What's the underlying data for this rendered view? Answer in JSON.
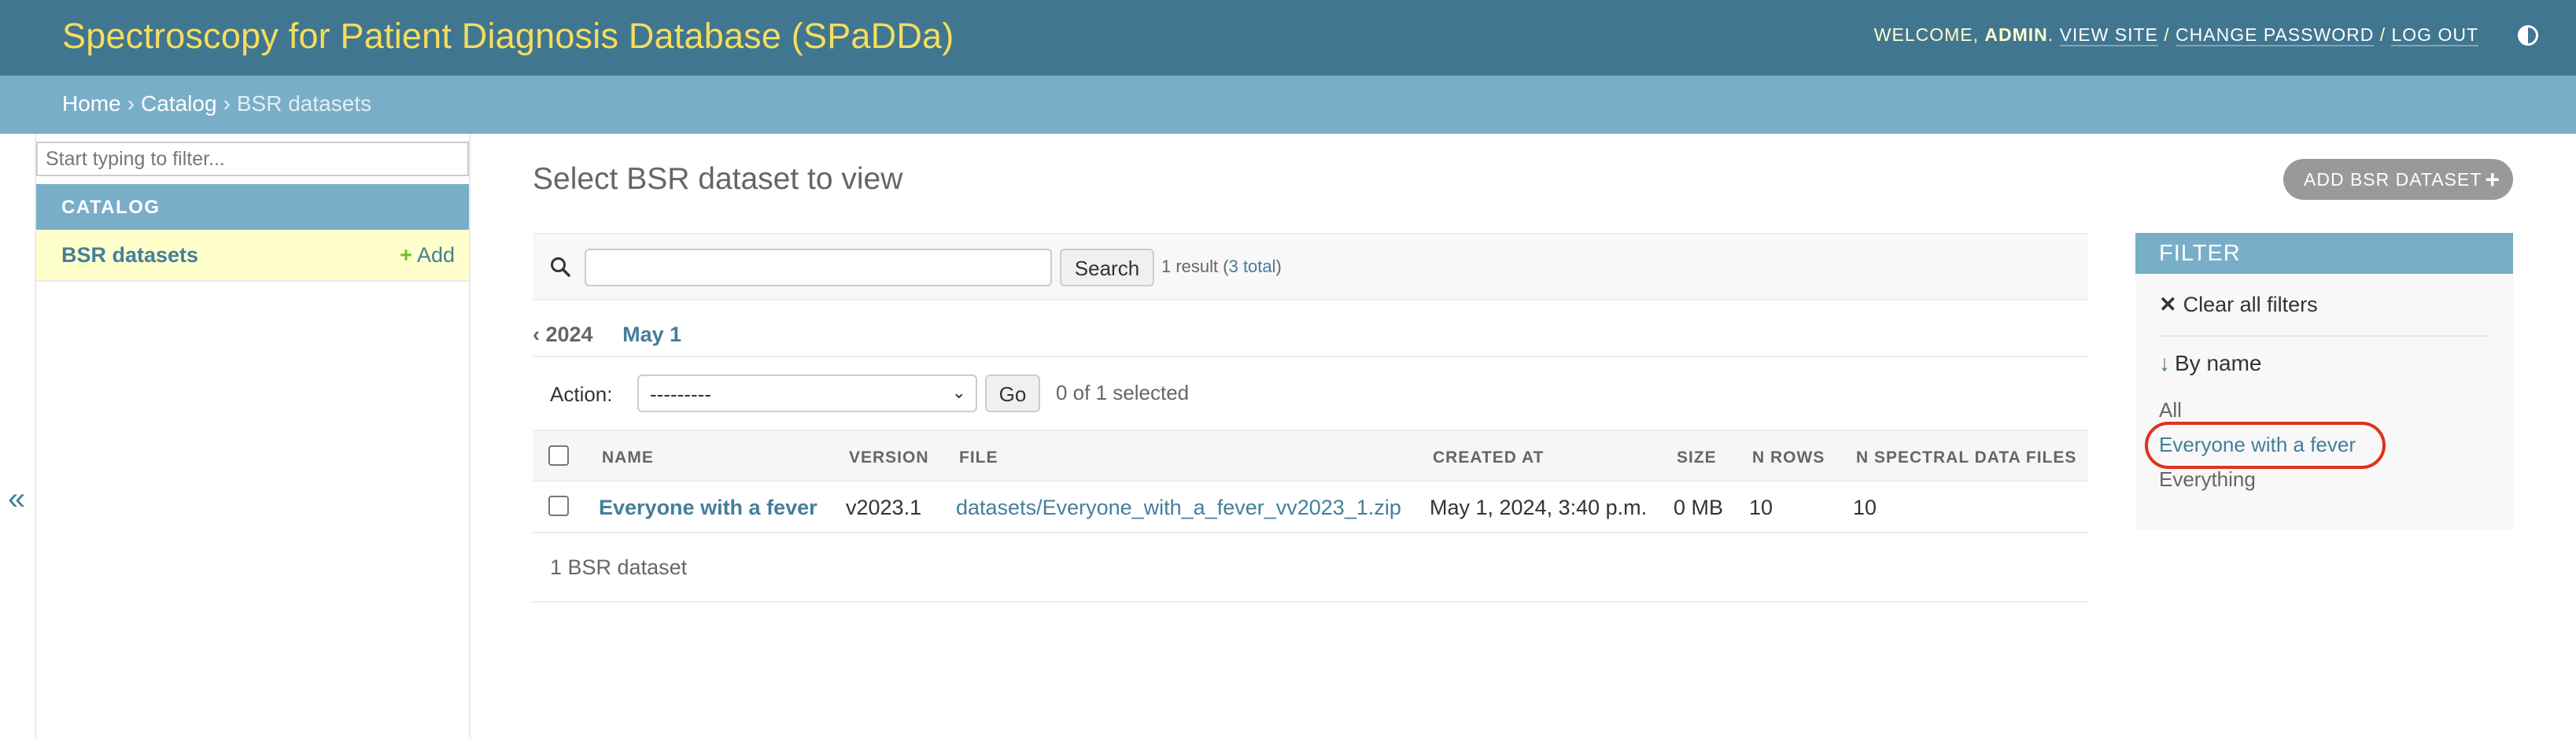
{
  "header": {
    "site_name": "Spectroscopy for Patient Diagnosis Database (SPaDDa)",
    "welcome": "WELCOME,",
    "user": "ADMIN",
    "view_site": "VIEW SITE",
    "change_password": "CHANGE PASSWORD",
    "log_out": "LOG OUT",
    "sep": "/"
  },
  "breadcrumbs": {
    "home": "Home",
    "catalog": "Catalog",
    "current": "BSR datasets",
    "sep": "›"
  },
  "sidebar": {
    "filter_placeholder": "Start typing to filter...",
    "app_label": "CATALOG",
    "model_label": "BSR datasets",
    "add_label": "Add",
    "add_icon": "+",
    "collapse_icon": "«"
  },
  "main": {
    "title": "Select BSR dataset to view",
    "add_button": "ADD BSR DATASET",
    "add_icon": "+",
    "search_button": "Search",
    "result_text": "1 result (",
    "result_total": "3 total",
    "result_close": ")",
    "date_back": "‹ 2024",
    "date_day": "May 1",
    "action_label": "Action:",
    "action_value": "---------",
    "go_button": "Go",
    "selected_count": "0 of 1 selected",
    "columns": [
      "NAME",
      "VERSION",
      "FILE",
      "CREATED AT",
      "SIZE",
      "N ROWS",
      "N SPECTRAL DATA FILES"
    ],
    "rows": [
      {
        "name": "Everyone with a fever",
        "version": "v2023.1",
        "file": "datasets/Everyone_with_a_fever_vv2023_1.zip",
        "created_at": "May 1, 2024, 3:40 p.m.",
        "size": "0 MB",
        "n_rows": "10",
        "n_spectral": "10"
      }
    ],
    "paginator": "1 BSR dataset"
  },
  "filter": {
    "title": "FILTER",
    "clear_icon": "✕",
    "clear_label": "Clear all filters",
    "section_arrow": "↓",
    "section_title": "By name",
    "options": [
      "All",
      "Everyone with a fever",
      "Everything"
    ],
    "selected_option": "Everyone with a fever"
  },
  "colors": {
    "header_bg": "#417690",
    "brand_text": "#f5dd5d",
    "breadcrumb_bg": "#79aec8",
    "link": "#447e9b",
    "highlight_ring": "#e0321c"
  }
}
